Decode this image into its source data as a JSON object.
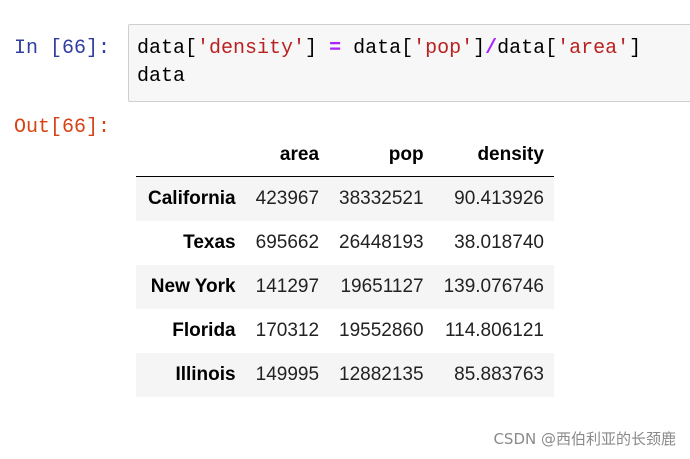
{
  "input_prompt": "In [66]:",
  "output_prompt": "Out[66]:",
  "code": {
    "line1": {
      "t1": "data[",
      "t2": "'density'",
      "t3": "] ",
      "t4": "=",
      "t5": " data[",
      "t6": "'pop'",
      "t7": "]",
      "t8": "/",
      "t9": "data[",
      "t10": "'area'",
      "t11": "]"
    },
    "line2": "data"
  },
  "table": {
    "columns": [
      "",
      "area",
      "pop",
      "density"
    ],
    "rows": [
      {
        "index": "California",
        "area": "423967",
        "pop": "38332521",
        "density": "90.413926"
      },
      {
        "index": "Texas",
        "area": "695662",
        "pop": "26448193",
        "density": "38.018740"
      },
      {
        "index": "New York",
        "area": "141297",
        "pop": "19651127",
        "density": "139.076746"
      },
      {
        "index": "Florida",
        "area": "170312",
        "pop": "19552860",
        "density": "114.806121"
      },
      {
        "index": "Illinois",
        "area": "149995",
        "pop": "12882135",
        "density": "85.883763"
      }
    ]
  },
  "watermark": "CSDN @西伯利亚的长颈鹿",
  "colors": {
    "input_prompt": "#303f9f",
    "output_prompt": "#d84315",
    "string": "#ba2121",
    "operator": "#aa22ff",
    "cell_background": "#f7f7f7",
    "row_stripe": "#f5f5f5"
  }
}
